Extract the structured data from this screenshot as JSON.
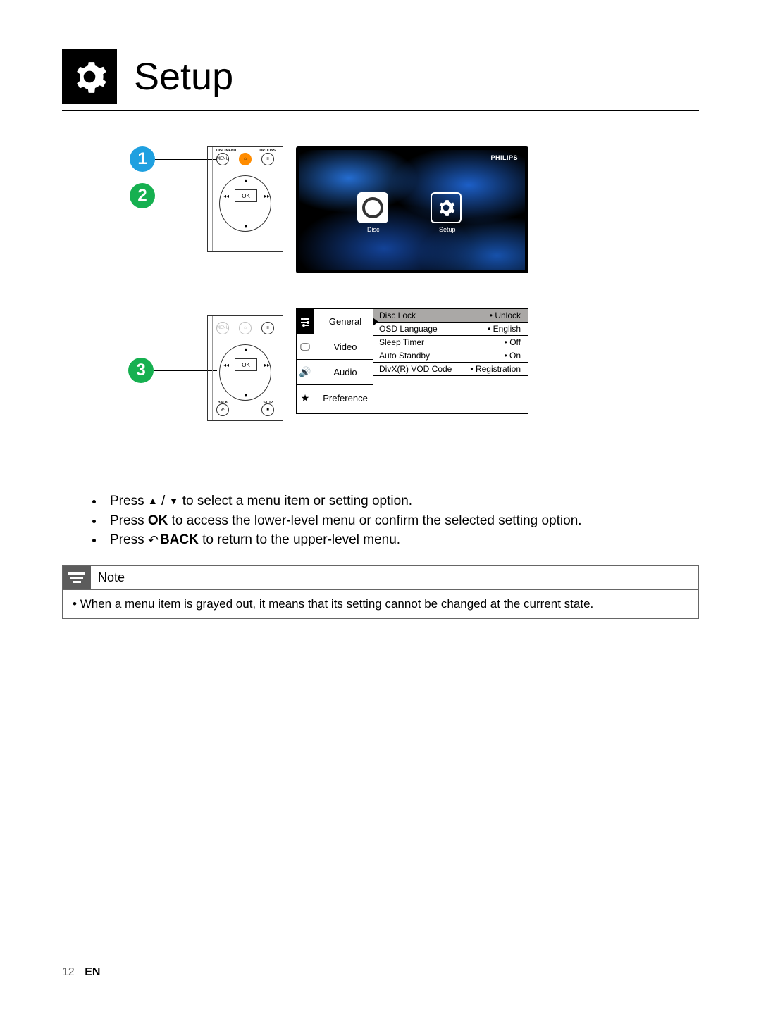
{
  "header": {
    "title": "Setup"
  },
  "callouts": {
    "one": "1",
    "two": "2",
    "three": "3"
  },
  "remote": {
    "top_left": "DISC MENU",
    "top_right": "OPTIONS",
    "ok": "OK",
    "back": "BACK",
    "stop": "STOP",
    "home_icon": "home-icon",
    "list_icon": "list-icon"
  },
  "tv": {
    "brand": "PHILIPS",
    "disc_label": "Disc",
    "setup_label": "Setup"
  },
  "menu": {
    "tabs": [
      {
        "label": "General",
        "active": true,
        "icon": "sliders-icon"
      },
      {
        "label": "Video",
        "active": false,
        "icon": "monitor-icon"
      },
      {
        "label": "Audio",
        "active": false,
        "icon": "speaker-icon"
      },
      {
        "label": "Preference",
        "active": false,
        "icon": "star-icon"
      }
    ],
    "settings": [
      {
        "key": "Disc Lock",
        "value": "Unlock"
      },
      {
        "key": "OSD Language",
        "value": "English"
      },
      {
        "key": "Sleep Timer",
        "value": "Off"
      },
      {
        "key": "Auto Standby",
        "value": "On"
      },
      {
        "key": "DivX(R) VOD Code",
        "value": "Registration"
      }
    ]
  },
  "instructions": {
    "i1a": "Press ",
    "i1b": " / ",
    "i1c": " to select a menu item or setting option.",
    "i2a": "Press ",
    "i2b": "OK",
    "i2c": " to access the lower-level menu or confirm the selected setting option.",
    "i3a": "Press ",
    "i3b": "BACK",
    "i3c": " to return to the upper-level menu."
  },
  "note": {
    "title": "Note",
    "body": "When a menu item is grayed out, it means that its setting cannot be changed at the current state."
  },
  "footer": {
    "page": "12",
    "lang": "EN"
  }
}
